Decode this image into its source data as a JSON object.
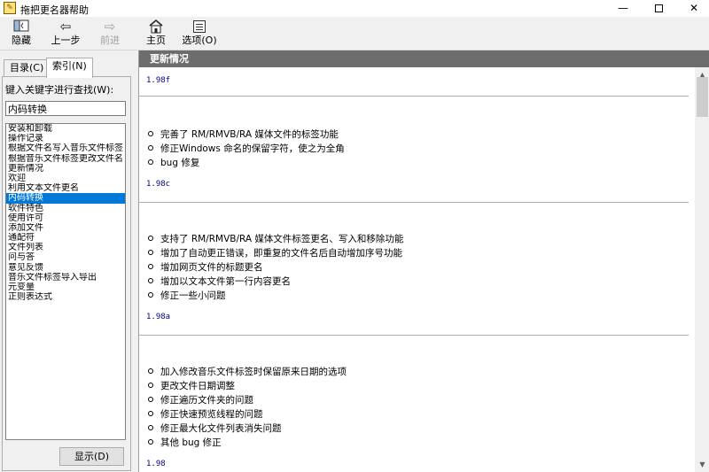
{
  "window": {
    "title": "拖把更名器帮助",
    "controls": {
      "minimize": "—",
      "close": "✕"
    }
  },
  "toolbar": {
    "hide_label": "隐藏",
    "back_label": "上一步",
    "forward_label": "前进",
    "home_label": "主页",
    "options_label": "选项(O)"
  },
  "left_pane": {
    "tabs": [
      {
        "label": "目录(C)"
      },
      {
        "label": "索引(N)",
        "active": true
      }
    ],
    "search_label": "键入关键字进行查找(W):",
    "search_value": "内码转换",
    "keywords": [
      "安装和卸载",
      "操作记录",
      "根据文件名写入音乐文件标签",
      "根据音乐文件标签更改文件名",
      "更新情况",
      "欢迎",
      "利用文本文件更名",
      "内码转换",
      "软件特色",
      "使用许可",
      "添加文件",
      "通配符",
      "文件列表",
      "问与答",
      "意见反馈",
      "音乐文件标签导入导出",
      "元变量",
      "正则表达式"
    ],
    "selected_keyword": "内码转换",
    "show_button": "显示(D)"
  },
  "content": {
    "header": "更新情况",
    "versions": [
      {
        "version": "1.98f",
        "changes": [
          "完善了 RM/RMVB/RA 媒体文件的标签功能",
          "修正Windows 命名的保留字符，使之为全角",
          "bug 修复"
        ]
      },
      {
        "version": "1.98c",
        "changes": [
          "支持了 RM/RMVB/RA 媒体文件标签更名、写入和移除功能",
          "增加了自动更正错误，即重复的文件名后自动增加序号功能",
          "增加网页文件的标题更名",
          "增加以文本文件第一行内容更名",
          "修正一些小问题"
        ]
      },
      {
        "version": "1.98a",
        "changes": [
          "加入修改音乐文件标签时保留原来日期的选项",
          "更改文件日期调整",
          "修正遍历文件夹的问题",
          "修正快速预览线程的问题",
          "修正最大化文件列表消失问题",
          "其他 bug 修正"
        ]
      },
      {
        "version": "1.98",
        "changes": []
      }
    ]
  }
}
